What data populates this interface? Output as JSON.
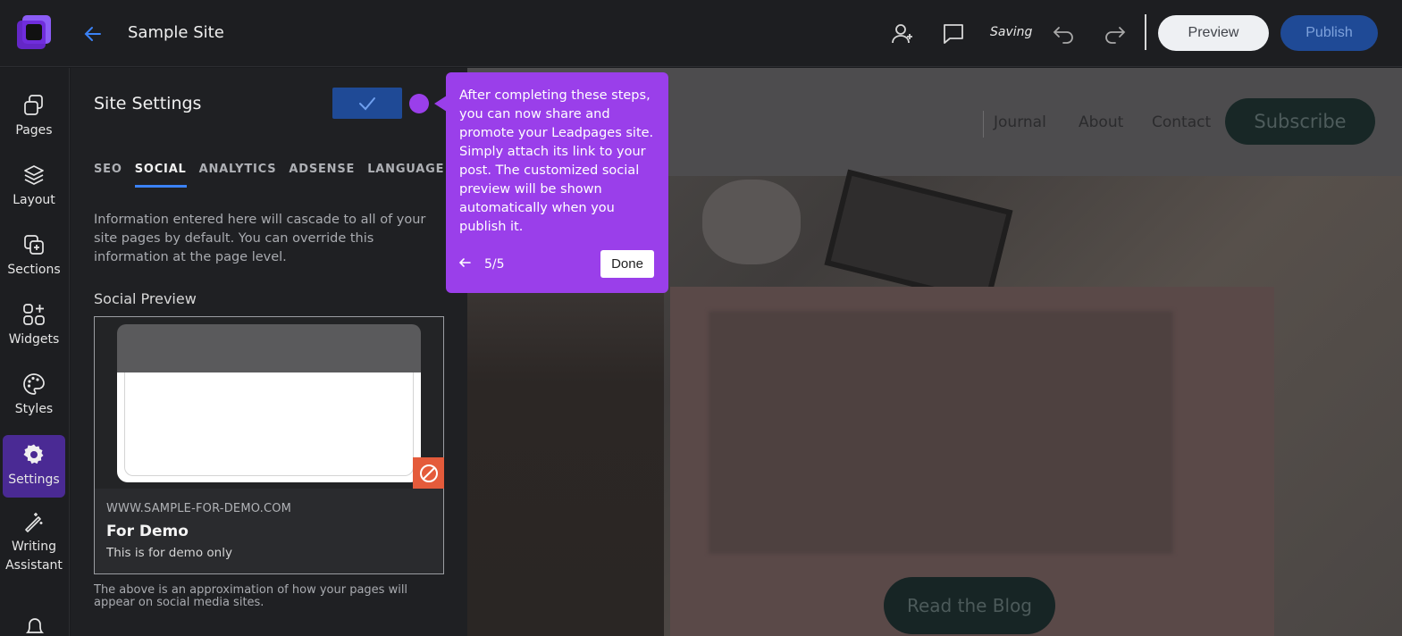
{
  "header": {
    "site_name": "Sample Site",
    "saving_status": "Saving",
    "preview_label": "Preview",
    "publish_label": "Publish",
    "icons": [
      "add-user-icon",
      "comment-icon",
      "undo-icon",
      "redo-icon"
    ]
  },
  "sidebar": {
    "items": [
      {
        "label": "Pages",
        "icon": "pages-icon"
      },
      {
        "label": "Layout",
        "icon": "layers-icon"
      },
      {
        "label": "Sections",
        "icon": "add-section-icon"
      },
      {
        "label": "Widgets",
        "icon": "widgets-icon"
      },
      {
        "label": "Styles",
        "icon": "palette-icon"
      },
      {
        "label": "Settings",
        "icon": "gear-icon",
        "active": true
      },
      {
        "label": "Writing Assistant",
        "icon": "magic-wand-icon"
      }
    ]
  },
  "panel": {
    "title": "Site Settings",
    "tabs": [
      {
        "label": "SEO"
      },
      {
        "label": "SOCIAL",
        "active": true
      },
      {
        "label": "ANALYTICS"
      },
      {
        "label": "ADSENSE"
      },
      {
        "label": "LANGUAGE"
      }
    ],
    "info_text": "Information entered here will cascade to all of your site pages by default. You can override this information at the page level.",
    "social_preview_label": "Social Preview",
    "preview": {
      "url": "WWW.SAMPLE-FOR-DEMO.COM",
      "title": "For Demo",
      "description": "This is for demo only"
    },
    "approx_note": "The above is an approximation of how your pages will appear on social media sites."
  },
  "canvas": {
    "nav": [
      "Journal",
      "About",
      "Contact"
    ],
    "subscribe_label": "Subscribe",
    "read_blog_label": "Read the Blog"
  },
  "tour": {
    "text": "After completing these steps, you can now share and promote your Leadpages site. Simply attach its link to your post. The customized social preview will be shown automatically when you publish it.",
    "step": "5/5",
    "done_label": "Done"
  },
  "colors": {
    "accent_purple": "#9a3fea",
    "active_nav": "#4a2a94",
    "publish_blue": "#1f4a96",
    "tab_underline": "#3b82f6",
    "remove_red": "#e45b3b"
  }
}
